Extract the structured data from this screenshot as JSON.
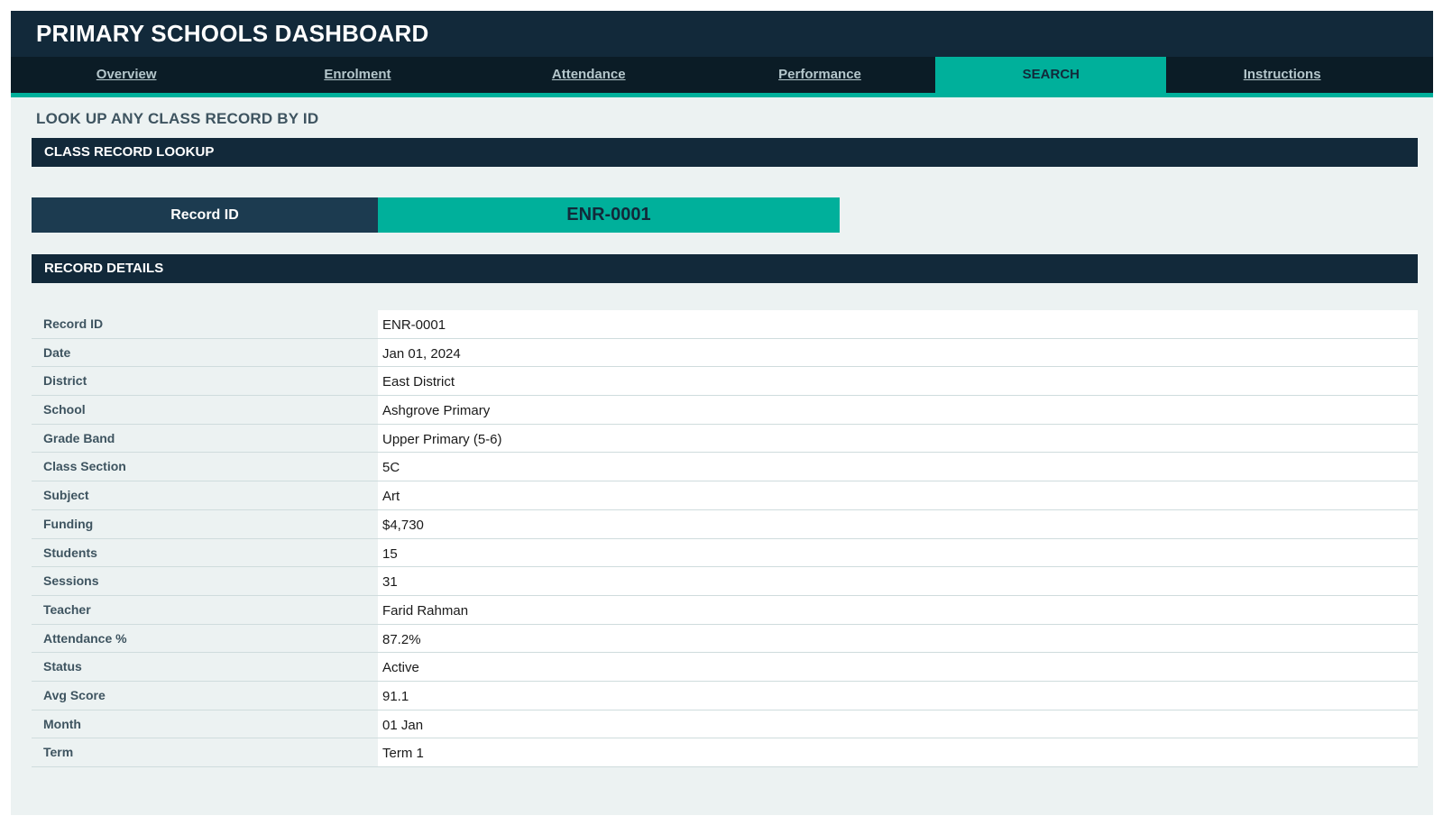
{
  "header": {
    "title": "PRIMARY SCHOOLS DASHBOARD"
  },
  "nav": {
    "tabs": [
      {
        "label": "Overview",
        "active": false
      },
      {
        "label": "Enrolment",
        "active": false
      },
      {
        "label": "Attendance",
        "active": false
      },
      {
        "label": "Performance",
        "active": false
      },
      {
        "label": "SEARCH",
        "active": true
      },
      {
        "label": "Instructions",
        "active": false
      }
    ]
  },
  "page": {
    "heading": "LOOK UP ANY CLASS RECORD BY ID"
  },
  "lookup": {
    "section_title": "CLASS RECORD LOOKUP",
    "label": "Record ID",
    "value": "ENR-0001"
  },
  "details": {
    "section_title": "RECORD DETAILS",
    "rows": [
      {
        "key": "Record ID",
        "value": "ENR-0001"
      },
      {
        "key": "Date",
        "value": "Jan 01, 2024"
      },
      {
        "key": "District",
        "value": "East District"
      },
      {
        "key": "School",
        "value": "Ashgrove Primary"
      },
      {
        "key": "Grade Band",
        "value": "Upper Primary (5-6)"
      },
      {
        "key": "Class Section",
        "value": "5C"
      },
      {
        "key": "Subject",
        "value": "Art"
      },
      {
        "key": "Funding",
        "value": "$4,730"
      },
      {
        "key": "Students",
        "value": "15"
      },
      {
        "key": "Sessions",
        "value": "31"
      },
      {
        "key": "Teacher",
        "value": "Farid Rahman"
      },
      {
        "key": "Attendance %",
        "value": "87.2%"
      },
      {
        "key": "Status",
        "value": "Active"
      },
      {
        "key": "Avg Score",
        "value": "91.1"
      },
      {
        "key": "Month",
        "value": "01 Jan"
      },
      {
        "key": "Term",
        "value": "Term 1"
      }
    ]
  },
  "colors": {
    "header_bg": "#12293a",
    "nav_bg": "#0b1c26",
    "accent": "#00b09b",
    "panel_bg": "#ecf2f2",
    "label_bg": "#1c3b50"
  }
}
